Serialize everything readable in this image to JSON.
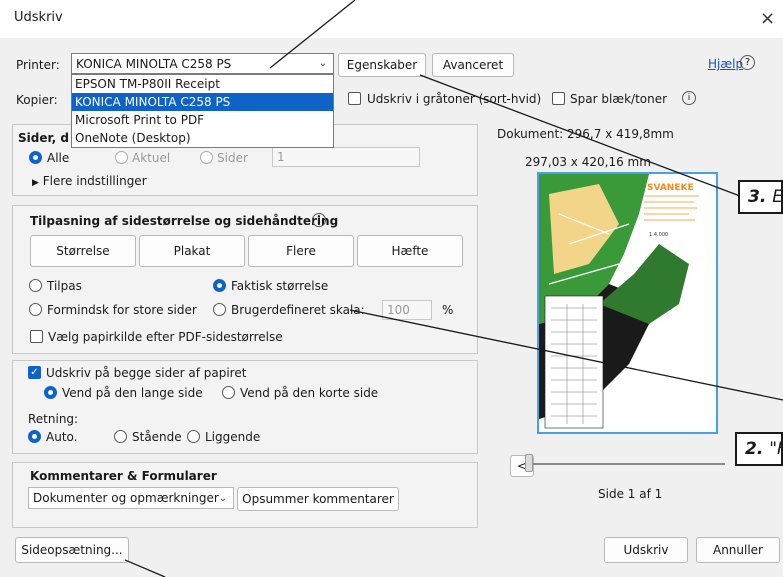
{
  "window": {
    "title": "Udskriv",
    "close_glyph": "×"
  },
  "printer": {
    "label": "Printer:",
    "selected": "KONICA MINOLTA C258 PS",
    "options": [
      "EPSON TM-P80II Receipt",
      "KONICA MINOLTA C258 PS",
      "Microsoft Print to PDF",
      "OneNote (Desktop)"
    ],
    "properties_label": "Egenskaber",
    "advanced_label": "Avanceret"
  },
  "help": {
    "label": "Hjælp",
    "glyph": "?"
  },
  "copies": {
    "label": "Kopier:"
  },
  "options": {
    "grayscale_label": "Udskriv i gråtoner (sort-hvid)",
    "save_ink_label": "Spar blæk/toner",
    "info_glyph": "i"
  },
  "pages": {
    "title": "Sider, d",
    "all_label": "Alle",
    "current_label": "Aktuel",
    "pages_label": "Sider",
    "pages_value": "1",
    "more_settings_label": "Flere indstillinger"
  },
  "sizing": {
    "title": "Tilpasning af sidestørrelse og sidehåndtering",
    "info_glyph": "i",
    "tabs": [
      "Størrelse",
      "Plakat",
      "Flere",
      "Hæfte"
    ],
    "fit_label": "Tilpas",
    "actual_size_label": "Faktisk størrelse",
    "shrink_label": "Formindsk for store sider",
    "custom_scale_label": "Brugerdefineret skala:",
    "scale_value": "100",
    "percent": "%",
    "paper_source_label": "Vælg papirkilde efter PDF-sidestørrelse"
  },
  "duplex": {
    "both_sides_label": "Udskriv på begge sider af papiret",
    "long_edge_label": "Vend på den lange side",
    "short_edge_label": "Vend på den korte side"
  },
  "orientation": {
    "title": "Retning:",
    "auto_label": "Auto.",
    "portrait_label": "Stående",
    "landscape_label": "Liggende"
  },
  "comments": {
    "title": "Kommentarer & Formularer",
    "selected": "Dokumenter og opmærkninger",
    "summarize_label": "Opsummer kommentarer"
  },
  "preview": {
    "document_label": "Dokument: 296,7 x 419,8mm",
    "size_label": "297,03 x 420,16 mm",
    "map_title": "SVANEKE",
    "map_scale": "1:4.000",
    "prev_glyph": "<",
    "page_label": "Side 1 af 1"
  },
  "footer": {
    "page_setup_label": "Sideopsætning...",
    "print_label": "Udskriv",
    "cancel_label": "Annuller"
  },
  "callouts": {
    "c3_num": "3.",
    "c3_text": "E",
    "c2_num": "2.",
    "c2_text": "\"F"
  },
  "colors": {
    "accent": "#0f62c8",
    "link": "#0a58c8",
    "map_border": "#4aa0e6",
    "map_orange": "#f28c1e",
    "map_green": "#3a9a3a"
  }
}
